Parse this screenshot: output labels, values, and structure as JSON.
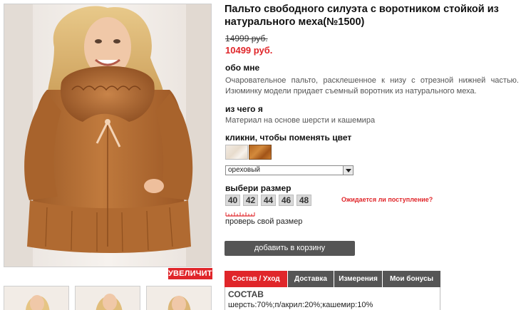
{
  "product": {
    "title": "Пальто свободного силуэта с воротником стойкой из натурального меха(№1500)",
    "old_price": "14999 руб.",
    "new_price": "10499 руб."
  },
  "gallery": {
    "zoom_label": "УВЕЛИЧИТЬ"
  },
  "about": {
    "heading": "обо мне",
    "text": "Очаровательное пальто, расклешенное к низу с отрезной нижней частью. Изюминку модели придает съемный воротник из натурального меха."
  },
  "material": {
    "heading": "из чего я",
    "text": "Материал на основе шерсти и кашемира"
  },
  "color": {
    "heading": "кликни, чтобы поменять цвет",
    "selected": "ореховый"
  },
  "size": {
    "heading": "выбери размер",
    "options": [
      "40",
      "42",
      "44",
      "46",
      "48"
    ],
    "arrival_link": "Ожидается ли поступление?",
    "check_link": "проверь свой размер"
  },
  "cart": {
    "button_label": "добавить в корзину"
  },
  "tabs": {
    "items": [
      "Состав / Уход",
      "Доставка",
      "Измерения",
      "Мои бонусы"
    ],
    "active": "Состав / Уход"
  },
  "composition": {
    "heading": "СОСТАВ",
    "text": "шерсть:70%;п/акрил:20%;кашемир:10%"
  },
  "colors": {
    "accent": "#e0262a",
    "button_gray": "#555555",
    "coat": "#b46c33"
  }
}
